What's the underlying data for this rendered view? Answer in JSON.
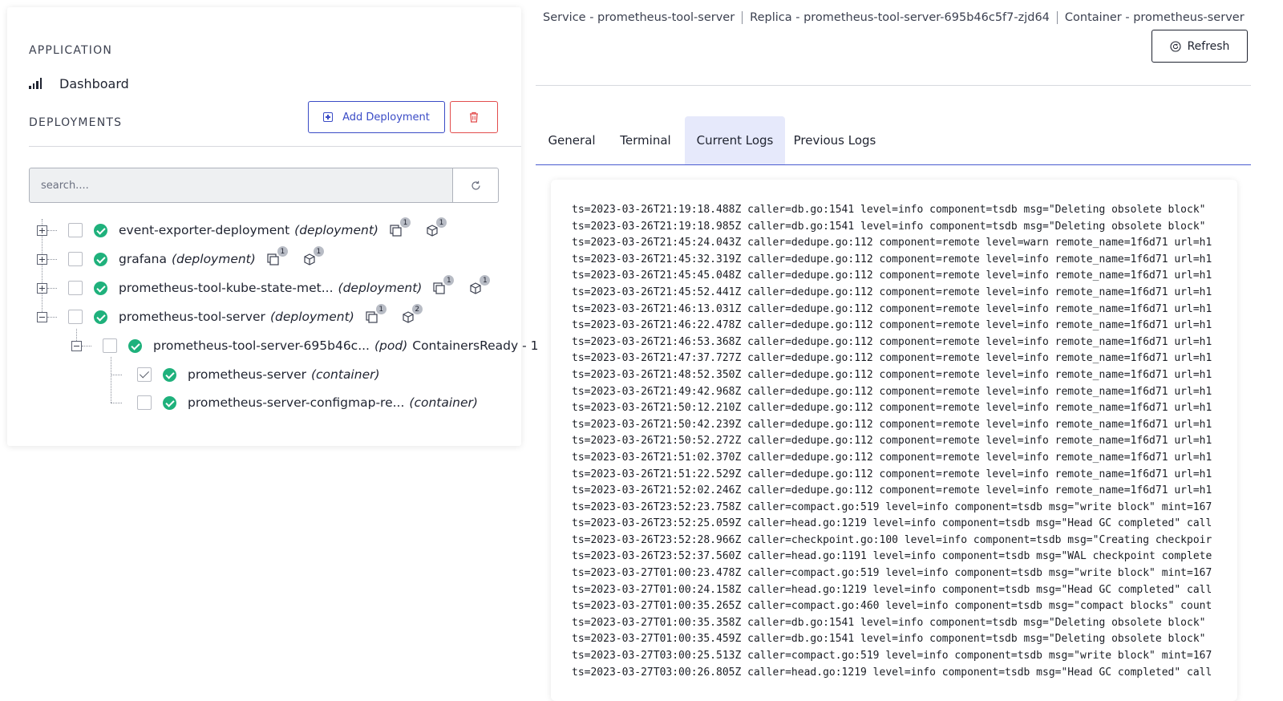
{
  "sidebar": {
    "application_label": "APPLICATION",
    "dashboard_label": "Dashboard",
    "deployments_label": "DEPLOYMENTS",
    "add_deployment_label": "Add Deployment",
    "search": {
      "placeholder": "search...."
    },
    "tree": [
      {
        "name": "event-exporter-deployment",
        "type": "(deployment)",
        "status": "ok",
        "checked": false,
        "expanded": false,
        "badges": {
          "replicas": "1",
          "pods": "1"
        }
      },
      {
        "name": "grafana",
        "type": "(deployment)",
        "status": "ok",
        "checked": false,
        "expanded": false,
        "badges": {
          "replicas": "1",
          "pods": "1"
        }
      },
      {
        "name": "prometheus-tool-kube-state-met...",
        "type": "(deployment)",
        "status": "ok",
        "checked": false,
        "expanded": false,
        "badges": {
          "replicas": "1",
          "pods": "1"
        }
      },
      {
        "name": "prometheus-tool-server",
        "type": "(deployment)",
        "status": "ok",
        "checked": false,
        "expanded": true,
        "badges": {
          "replicas": "1",
          "pods": "2"
        }
      },
      {
        "name": "prometheus-tool-server-695b46c...",
        "type": "(pod)",
        "extra": "ContainersReady - 1",
        "status": "ok",
        "checked": false,
        "expanded": true
      },
      {
        "name": "prometheus-server",
        "type": "(container)",
        "status": "ok",
        "checked": true
      },
      {
        "name": "prometheus-server-configmap-re...",
        "type": "(container)",
        "status": "ok",
        "checked": false
      }
    ]
  },
  "header": {
    "breadcrumb": {
      "service": "Service - prometheus-tool-server",
      "replica": "Replica - prometheus-tool-server-695b46c5f7-zjd64",
      "container": "Container - prometheus-server"
    },
    "refresh_label": "Refresh"
  },
  "tabs": [
    {
      "label": "General",
      "active": false
    },
    {
      "label": "Terminal",
      "active": false
    },
    {
      "label": "Current Logs",
      "active": true
    },
    {
      "label": "Previous Logs",
      "active": false
    }
  ],
  "logs": [
    "ts=2023-03-26T21:19:18.488Z caller=db.go:1541 level=info component=tsdb msg=\"Deleting obsolete block\"",
    "ts=2023-03-26T21:19:18.985Z caller=db.go:1541 level=info component=tsdb msg=\"Deleting obsolete block\"",
    "ts=2023-03-26T21:45:24.043Z caller=dedupe.go:112 component=remote level=warn remote_name=1f6d71 url=h1",
    "ts=2023-03-26T21:45:32.319Z caller=dedupe.go:112 component=remote level=info remote_name=1f6d71 url=h1",
    "ts=2023-03-26T21:45:45.048Z caller=dedupe.go:112 component=remote level=info remote_name=1f6d71 url=h1",
    "ts=2023-03-26T21:45:52.441Z caller=dedupe.go:112 component=remote level=info remote_name=1f6d71 url=h1",
    "ts=2023-03-26T21:46:13.031Z caller=dedupe.go:112 component=remote level=info remote_name=1f6d71 url=h1",
    "ts=2023-03-26T21:46:22.478Z caller=dedupe.go:112 component=remote level=info remote_name=1f6d71 url=h1",
    "ts=2023-03-26T21:46:53.368Z caller=dedupe.go:112 component=remote level=info remote_name=1f6d71 url=h1",
    "ts=2023-03-26T21:47:37.727Z caller=dedupe.go:112 component=remote level=info remote_name=1f6d71 url=h1",
    "ts=2023-03-26T21:48:52.350Z caller=dedupe.go:112 component=remote level=info remote_name=1f6d71 url=h1",
    "ts=2023-03-26T21:49:42.968Z caller=dedupe.go:112 component=remote level=info remote_name=1f6d71 url=h1",
    "ts=2023-03-26T21:50:12.210Z caller=dedupe.go:112 component=remote level=info remote_name=1f6d71 url=h1",
    "ts=2023-03-26T21:50:42.239Z caller=dedupe.go:112 component=remote level=info remote_name=1f6d71 url=h1",
    "ts=2023-03-26T21:50:52.272Z caller=dedupe.go:112 component=remote level=info remote_name=1f6d71 url=h1",
    "ts=2023-03-26T21:51:02.370Z caller=dedupe.go:112 component=remote level=info remote_name=1f6d71 url=h1",
    "ts=2023-03-26T21:51:22.529Z caller=dedupe.go:112 component=remote level=info remote_name=1f6d71 url=h1",
    "ts=2023-03-26T21:52:02.246Z caller=dedupe.go:112 component=remote level=info remote_name=1f6d71 url=h1",
    "ts=2023-03-26T23:52:23.758Z caller=compact.go:519 level=info component=tsdb msg=\"write block\" mint=167",
    "ts=2023-03-26T23:52:25.059Z caller=head.go:1219 level=info component=tsdb msg=\"Head GC completed\" call",
    "ts=2023-03-26T23:52:28.966Z caller=checkpoint.go:100 level=info component=tsdb msg=\"Creating checkpoir",
    "ts=2023-03-26T23:52:37.560Z caller=head.go:1191 level=info component=tsdb msg=\"WAL checkpoint complete",
    "ts=2023-03-27T01:00:23.478Z caller=compact.go:519 level=info component=tsdb msg=\"write block\" mint=167",
    "ts=2023-03-27T01:00:24.158Z caller=head.go:1219 level=info component=tsdb msg=\"Head GC completed\" call",
    "ts=2023-03-27T01:00:35.265Z caller=compact.go:460 level=info component=tsdb msg=\"compact blocks\" count",
    "ts=2023-03-27T01:00:35.358Z caller=db.go:1541 level=info component=tsdb msg=\"Deleting obsolete block\"",
    "ts=2023-03-27T01:00:35.459Z caller=db.go:1541 level=info component=tsdb msg=\"Deleting obsolete block\"",
    "ts=2023-03-27T03:00:25.513Z caller=compact.go:519 level=info component=tsdb msg=\"write block\" mint=167",
    "ts=2023-03-27T03:00:26.805Z caller=head.go:1219 level=info component=tsdb msg=\"Head GC completed\" call"
  ],
  "colors": {
    "accent": "#3a4bc6",
    "danger": "#e24d4d",
    "success": "#1fb17c",
    "active_tab_bg": "#e6e9fb"
  },
  "icons": {
    "dashboard": "bar-chart-icon",
    "add": "plus-square-icon",
    "delete": "trash-icon",
    "search_refresh": "refresh-icon",
    "header_refresh": "refresh-circle-icon",
    "replicas": "copy-icon",
    "pods": "cube-icon",
    "status": "check-circle-icon"
  }
}
